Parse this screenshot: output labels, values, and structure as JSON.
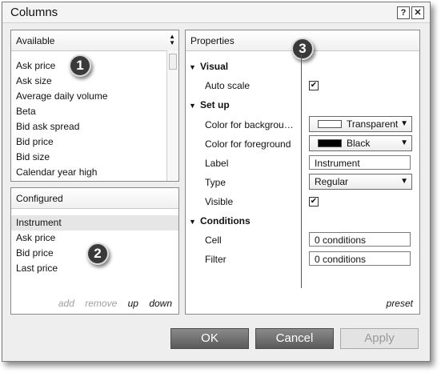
{
  "window": {
    "title": "Columns",
    "help_label": "?",
    "close_label": "✕"
  },
  "available": {
    "header": "Available",
    "items": [
      "Ask price",
      "Ask size",
      "Average daily volume",
      "Beta",
      "Bid ask spread",
      "Bid price",
      "Bid size",
      "Calendar year high"
    ]
  },
  "configured": {
    "header": "Configured",
    "items": [
      "Instrument",
      "Ask price",
      "Bid price",
      "Last price"
    ],
    "selected": "Instrument",
    "links": {
      "add": "add",
      "remove": "remove",
      "up": "up",
      "down": "down"
    }
  },
  "properties": {
    "header": "Properties",
    "sections": {
      "visual": "Visual",
      "setup": "Set up",
      "conditions": "Conditions"
    },
    "rows": {
      "auto_scale": "Auto scale",
      "color_bg": "Color for backgrou…",
      "color_fg": "Color for foreground",
      "label": "Label",
      "type": "Type",
      "visible": "Visible",
      "cell": "Cell",
      "filter": "Filter"
    },
    "values": {
      "auto_scale_checked": "✔",
      "color_bg": "Transparent",
      "color_fg": "Black",
      "label": "Instrument",
      "type": "Regular",
      "visible_checked": "✔",
      "cell": "0 conditions",
      "filter": "0 conditions"
    },
    "preset": "preset"
  },
  "badges": [
    "1",
    "2",
    "3"
  ],
  "buttons": {
    "ok": "OK",
    "cancel": "Cancel",
    "apply": "Apply"
  },
  "colors": {
    "fg_swatch": "#000000",
    "bg_swatch": "#ffffff"
  }
}
